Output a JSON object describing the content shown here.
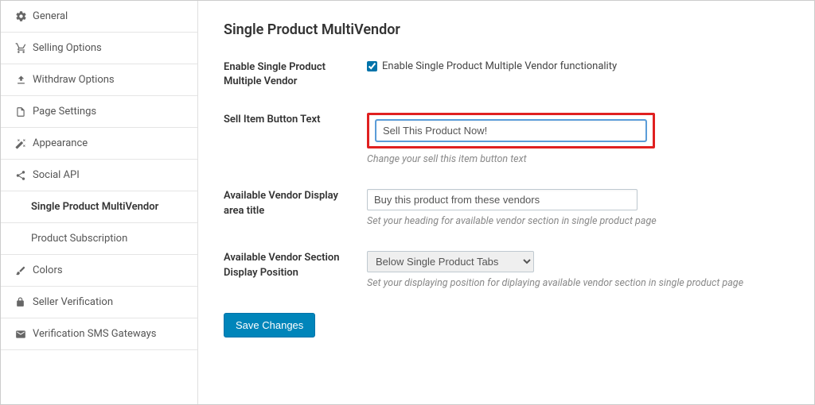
{
  "sidebar": {
    "items": [
      {
        "label": "General"
      },
      {
        "label": "Selling Options"
      },
      {
        "label": "Withdraw Options"
      },
      {
        "label": "Page Settings"
      },
      {
        "label": "Appearance"
      },
      {
        "label": "Social API"
      },
      {
        "label": "Colors"
      },
      {
        "label": "Seller Verification"
      },
      {
        "label": "Verification SMS Gateways"
      }
    ],
    "sub": [
      {
        "label": "Single Product MultiVendor"
      },
      {
        "label": "Product Subscription"
      }
    ]
  },
  "page": {
    "title": "Single Product MultiVendor"
  },
  "form": {
    "enable": {
      "label": "Enable Single Product Multiple Vendor",
      "checkbox_label": "Enable Single Product Multiple Vendor functionality",
      "checked": true
    },
    "sell_button": {
      "label": "Sell Item Button Text",
      "value": "Sell This Product Now!",
      "hint": "Change your sell this item button text"
    },
    "vendor_title": {
      "label": "Available Vendor Display area title",
      "value": "Buy this product from these vendors",
      "hint": "Set your heading for available vendor section in single product page"
    },
    "vendor_position": {
      "label": "Available Vendor Section Display Position",
      "selected": "Below Single Product Tabs",
      "hint": "Set your displaying position for diplaying available vendor section in single product page"
    },
    "save": "Save Changes"
  }
}
